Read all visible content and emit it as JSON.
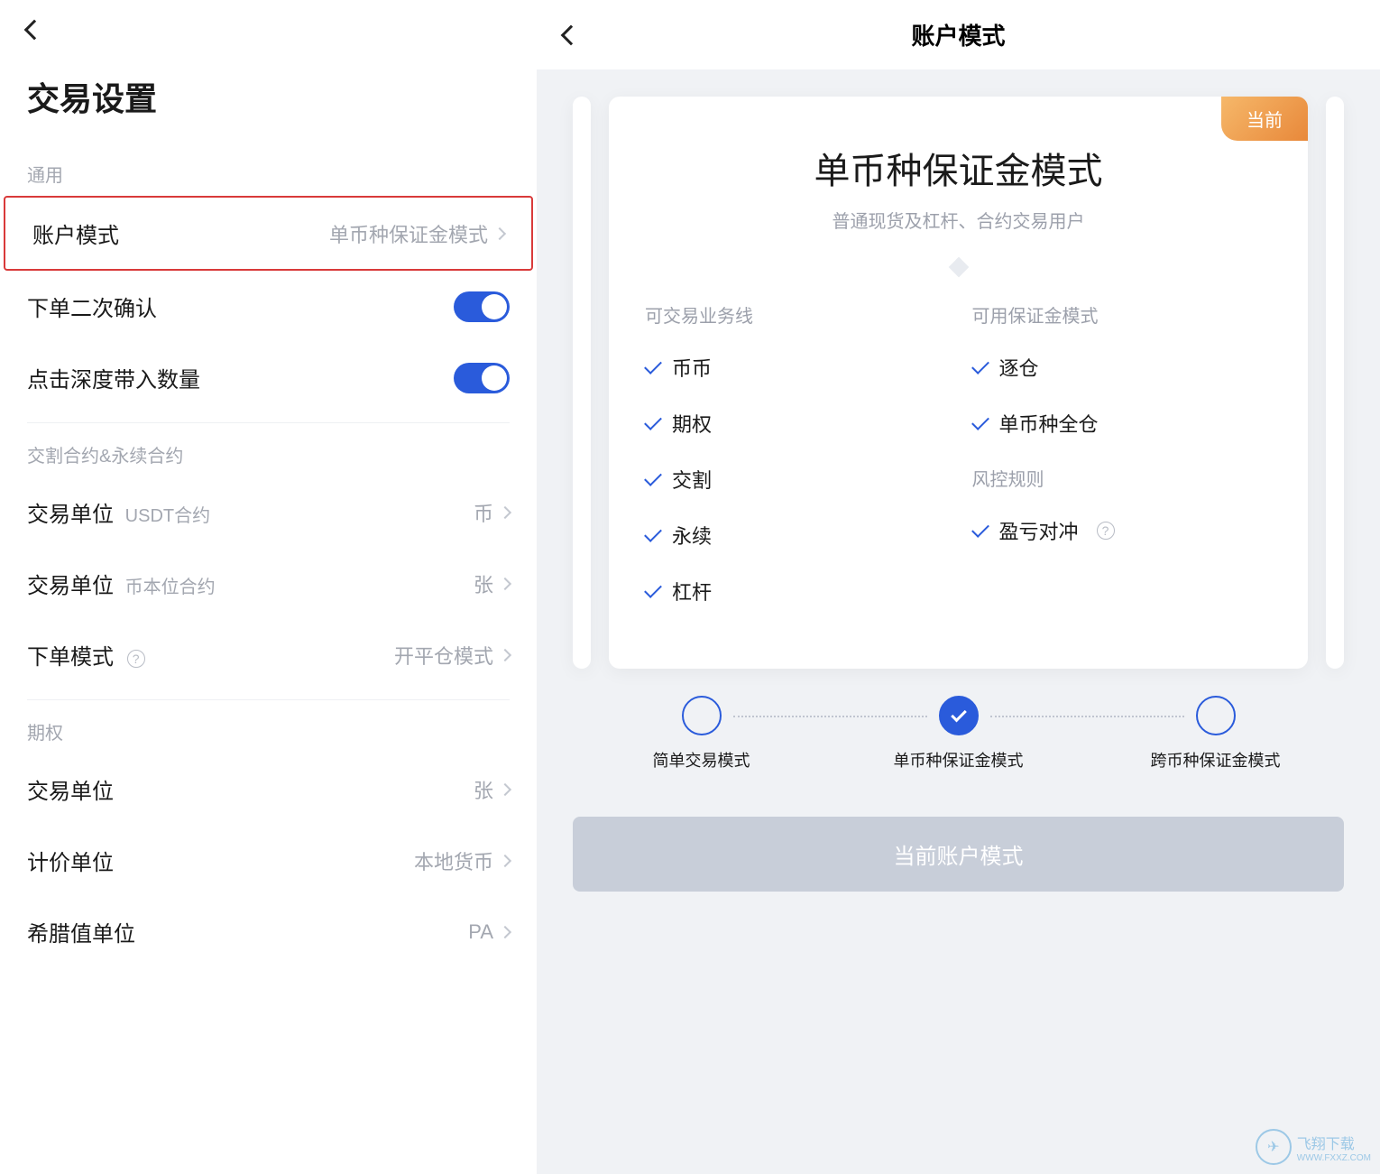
{
  "left": {
    "page_title": "交易设置",
    "sections": {
      "general": {
        "header": "通用",
        "account_mode": {
          "label": "账户模式",
          "value": "单币种保证金模式"
        },
        "order_confirm": {
          "label": "下单二次确认"
        },
        "depth_quantity": {
          "label": "点击深度带入数量"
        }
      },
      "futures": {
        "header": "交割合约&永续合约",
        "unit_usdt": {
          "label": "交易单位",
          "sub": "USDT合约",
          "value": "币"
        },
        "unit_coin": {
          "label": "交易单位",
          "sub": "币本位合约",
          "value": "张"
        },
        "order_mode": {
          "label": "下单模式",
          "value": "开平仓模式"
        }
      },
      "options": {
        "header": "期权",
        "unit": {
          "label": "交易单位",
          "value": "张"
        },
        "quote_unit": {
          "label": "计价单位",
          "value": "本地货币"
        },
        "greek_unit": {
          "label": "希腊值单位",
          "value": "PA"
        }
      }
    }
  },
  "right": {
    "header_title": "账户模式",
    "badge": "当前",
    "card_title": "单币种保证金模式",
    "card_subtitle": "普通现货及杠杆、合约交易用户",
    "columns": {
      "trade_lines": {
        "header": "可交易业务线",
        "items": [
          "币币",
          "期权",
          "交割",
          "永续",
          "杠杆"
        ]
      },
      "margin_modes": {
        "header": "可用保证金模式",
        "items": [
          "逐仓",
          "单币种全仓"
        ]
      },
      "risk": {
        "header": "风控规则",
        "items": [
          "盈亏对冲"
        ]
      }
    },
    "steps": [
      "简单交易模式",
      "单币种保证金模式",
      "跨币种保证金模式"
    ],
    "button": "当前账户模式",
    "watermark": "飞翔下载",
    "watermark_url": "WWW.FXXZ.COM"
  }
}
